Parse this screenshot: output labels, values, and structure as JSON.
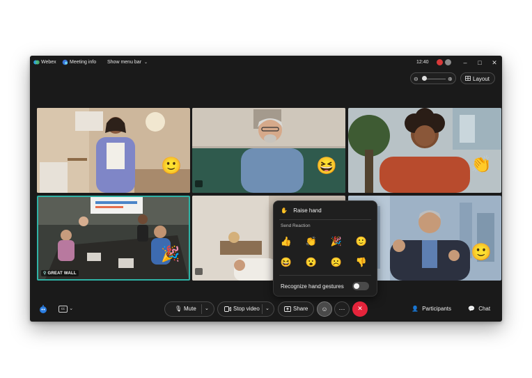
{
  "titlebar": {
    "app_name": "Webex",
    "meeting_info": "Meeting info",
    "show_menu_bar": "Show menu bar",
    "time": "12:40"
  },
  "top_controls": {
    "layout_label": "Layout"
  },
  "tiles": [
    {
      "emoji": "🙂"
    },
    {
      "emoji": "😆"
    },
    {
      "emoji": "👏"
    },
    {
      "label": "GREAT WALL",
      "emoji": "🎉"
    },
    {},
    {
      "emoji": "🙂"
    }
  ],
  "reactions_popover": {
    "raise_hand": "Raise hand",
    "send_reaction": "Send Reaction",
    "reactions": [
      "👍",
      "👏",
      "🎉",
      "🙂",
      "😆",
      "😮",
      "☹️",
      "👎"
    ],
    "recognize_gestures": "Recognize hand gestures",
    "recognize_gestures_enabled": false
  },
  "controls": {
    "mute": "Mute",
    "stop_video": "Stop video",
    "share": "Share",
    "participants": "Participants",
    "chat": "Chat"
  },
  "colors": {
    "active_speaker_border": "#2fb3a6",
    "end_call": "#e5243b",
    "window_bg": "#1a1a1a"
  }
}
